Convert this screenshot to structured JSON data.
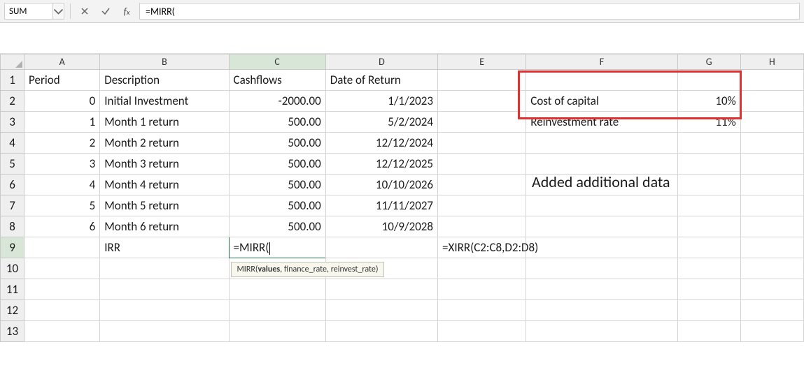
{
  "nameBox": "SUM",
  "formulaBar": "=MIRR(",
  "tooltip": {
    "fn": "MIRR(",
    "bold": "values",
    "rest": ", finance_rate, reinvest_rate)"
  },
  "columns": [
    "A",
    "B",
    "C",
    "D",
    "E",
    "F",
    "G",
    "H"
  ],
  "rows": 13,
  "activeCell": "C9",
  "headers": {
    "A1": "Period",
    "B1": "Description",
    "C1": "Cashflows",
    "D1": "Date of Return"
  },
  "data": {
    "A2": "0",
    "B2": "Initial Investment",
    "C2": "-2000.00",
    "D2": "1/1/2023",
    "A3": "1",
    "B3": "Month 1 return",
    "C3": "500.00",
    "D3": "5/2/2024",
    "A4": "2",
    "B4": "Month 2 return",
    "C4": "500.00",
    "D4": "12/12/2024",
    "A5": "3",
    "B5": "Month 3 return",
    "C5": "500.00",
    "D5": "12/12/2025",
    "A6": "4",
    "B6": "Month 4 return",
    "C6": "500.00",
    "D6": "10/10/2026",
    "A7": "5",
    "B7": "Month 5 return",
    "C7": "500.00",
    "D7": "11/11/2027",
    "A8": "6",
    "B8": "Month 6 return",
    "C8": "500.00",
    "D8": "10/9/2028",
    "B9": "IRR",
    "C9": "=MIRR(",
    "E9": "=XIRR(C2:C8,D2:D8)",
    "F2": "Cost of capital",
    "G2": "10%",
    "F3": "Reinvestment rate",
    "G3": "11%"
  },
  "annotation": "Added additional data"
}
